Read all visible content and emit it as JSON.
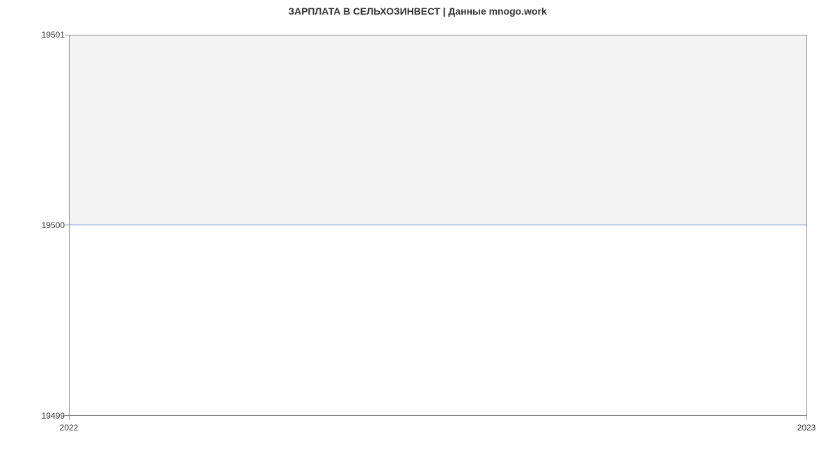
{
  "chart_data": {
    "type": "area",
    "title": "ЗАРПЛАТА В СЕЛЬХОЗИНВЕСТ | Данные mnogo.work",
    "x": [
      2022,
      2023
    ],
    "values": [
      19500,
      19500
    ],
    "xlabel": "",
    "ylabel": "",
    "xlim": [
      2022,
      2023
    ],
    "ylim": [
      19499,
      19501
    ],
    "xticks": [
      "2022",
      "2023"
    ],
    "yticks": [
      "19499",
      "19500",
      "19501"
    ]
  }
}
